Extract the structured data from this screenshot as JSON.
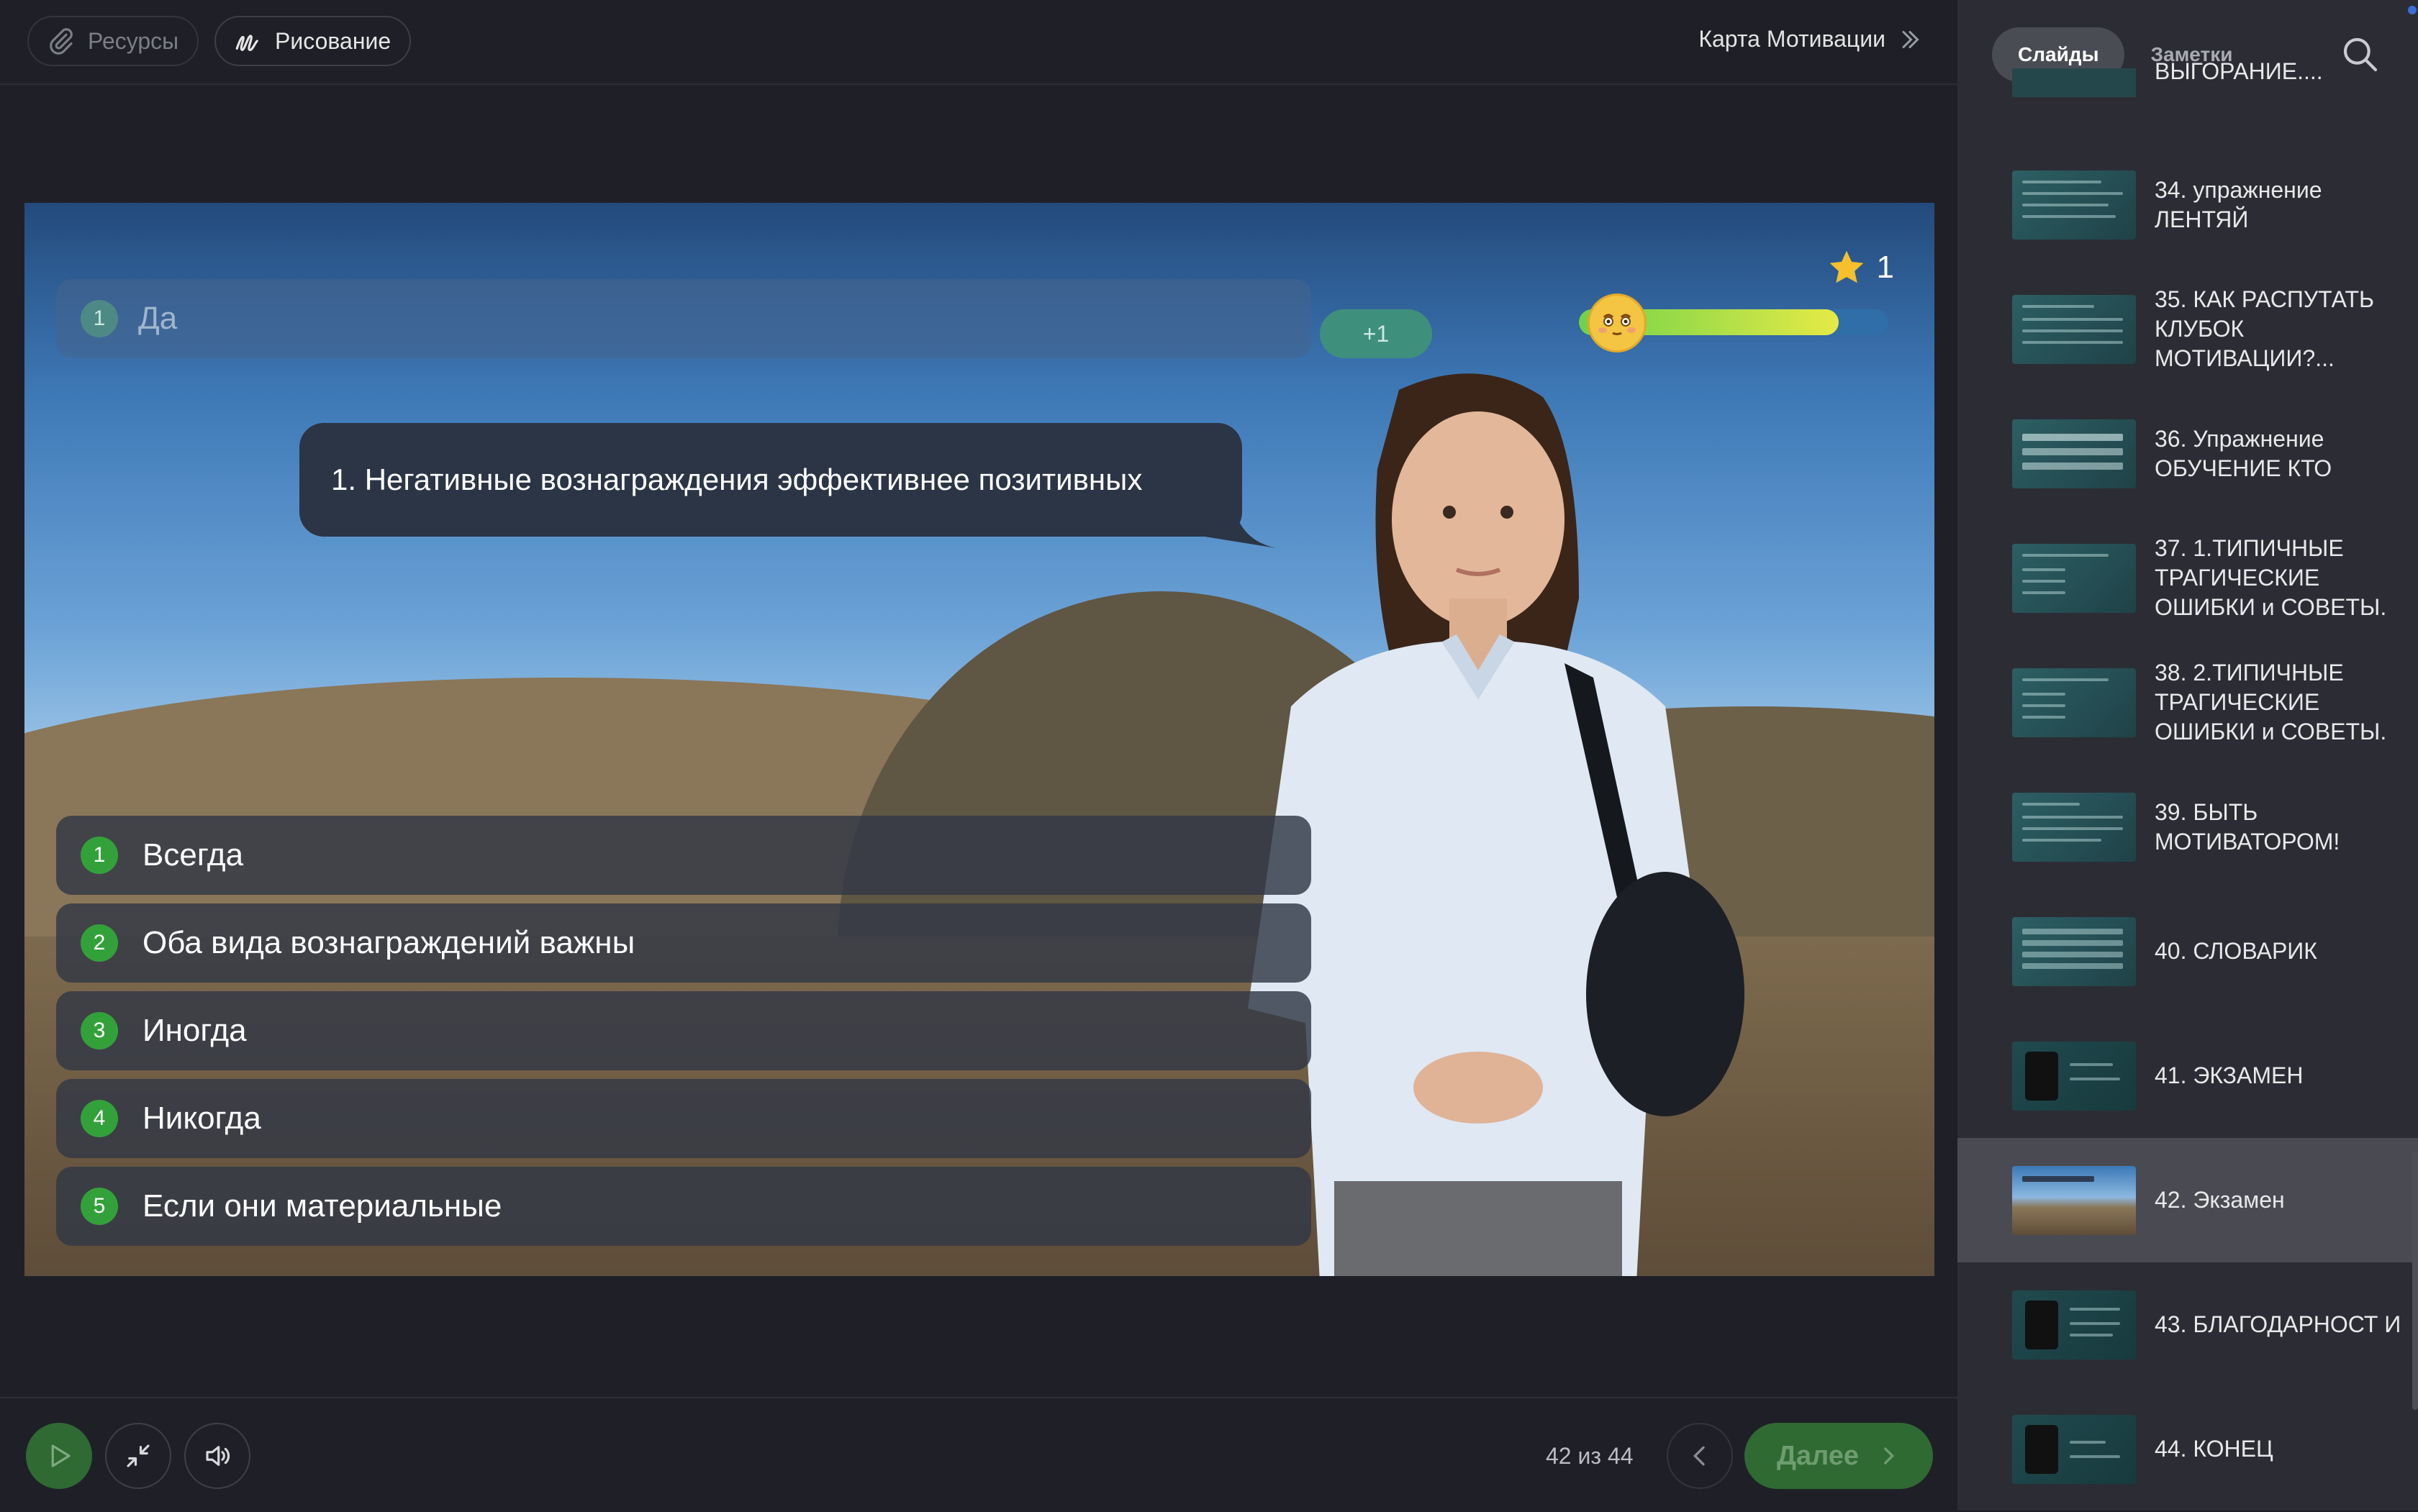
{
  "toolbar": {
    "resources_label": "Ресурсы",
    "drawing_label": "Рисование",
    "course_title": "Карта Мотивации"
  },
  "slide": {
    "answer_number": "1",
    "answer_text": "Да",
    "plus_badge": "+1",
    "score": "1",
    "progress_fraction": 0.84,
    "question": "1. Негативные вознаграждения эффективнее позитивных",
    "options": [
      {
        "num": "1",
        "text": "Всегда"
      },
      {
        "num": "2",
        "text": "Оба вида вознаграждений важны"
      },
      {
        "num": "3",
        "text": "Иногда"
      },
      {
        "num": "4",
        "text": "Никогда"
      },
      {
        "num": "5",
        "text": "Если они материальные"
      }
    ]
  },
  "player": {
    "counter": "42 из 44",
    "next_label": "Далее"
  },
  "sidebar": {
    "tabs": [
      "Слайды",
      "Заметки"
    ],
    "partial_label": "ВЫГОРАНИЕ....",
    "slides": [
      {
        "label": "34. упражнение ЛЕНТЯЙ"
      },
      {
        "label": "35. КАК РАСПУТАТЬ КЛУБОК МОТИВАЦИИ?..."
      },
      {
        "label": "36. Упражнение ОБУЧЕНИЕ КТО"
      },
      {
        "label": "37. 1.ТИПИЧНЫЕ ТРАГИЧЕСКИЕ ОШИБКИ и СОВЕТЫ."
      },
      {
        "label": "38. 2.ТИПИЧНЫЕ ТРАГИЧЕСКИЕ ОШИБКИ и СОВЕТЫ."
      },
      {
        "label": "39. БЫТЬ МОТИВАТОРОМ!"
      },
      {
        "label": "40. СЛОВАРИК"
      },
      {
        "label": "41. ЭКЗАМЕН"
      },
      {
        "label": "42. Экзамен"
      },
      {
        "label": "43. БЛАГОДАРНОСТ И"
      },
      {
        "label": "44. КОНЕЦ"
      }
    ],
    "selected_index": 8
  },
  "colors": {
    "accent_green": "#33a13a",
    "button_green": "#2f6a32",
    "bubble": "#2b3545"
  },
  "icons": [
    "paperclip-icon",
    "drawing-icon",
    "chevrons-right-icon",
    "star-icon",
    "emoji-icon",
    "play-icon",
    "collapse-icon",
    "volume-icon",
    "chevron-left-icon",
    "chevron-right-icon",
    "search-icon"
  ]
}
